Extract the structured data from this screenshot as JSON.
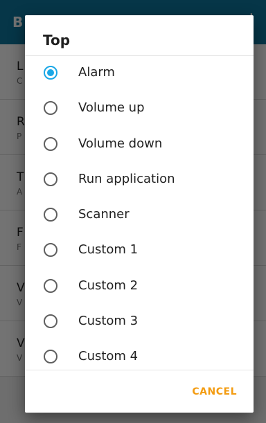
{
  "background": {
    "app_bar": {
      "title_initial": "B",
      "overflow_glyph": "⋮"
    },
    "rows": [
      {
        "t": "L",
        "s": "C"
      },
      {
        "t": "R",
        "s": "P"
      },
      {
        "t": "T",
        "s": "A"
      },
      {
        "t": "F",
        "s": "F"
      },
      {
        "t": "V",
        "s": "V"
      },
      {
        "t": "V",
        "s": "V"
      }
    ]
  },
  "dialog": {
    "title": "Top",
    "options": [
      {
        "label": "Alarm",
        "selected": true
      },
      {
        "label": "Volume up",
        "selected": false
      },
      {
        "label": "Volume down",
        "selected": false
      },
      {
        "label": "Run application",
        "selected": false
      },
      {
        "label": "Scanner",
        "selected": false
      },
      {
        "label": "Custom 1",
        "selected": false
      },
      {
        "label": "Custom 2",
        "selected": false
      },
      {
        "label": "Custom 3",
        "selected": false
      },
      {
        "label": "Custom 4",
        "selected": false
      }
    ],
    "cancel_label": "CANCEL"
  },
  "colors": {
    "app_bar": "#0f79a0",
    "radio_selected": "#1aa7e6",
    "cancel_accent": "#f39c12"
  }
}
